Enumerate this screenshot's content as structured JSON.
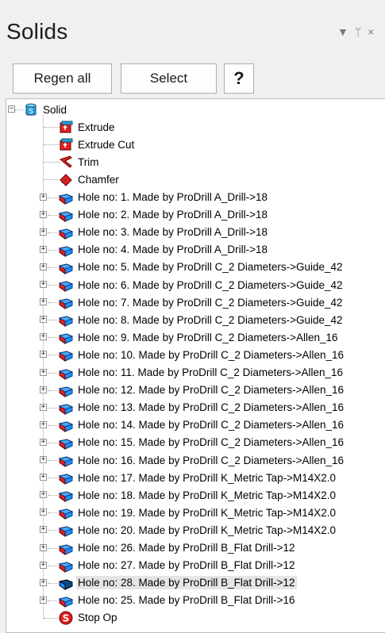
{
  "panel": {
    "title": "Solids",
    "controls": [
      "▼",
      "ᛘ",
      "×"
    ]
  },
  "toolbar": {
    "regen_label": "Regen all",
    "select_label": "Select",
    "help_label": "?"
  },
  "tree": {
    "root": {
      "label": "Solid",
      "icon": "solid-cylinder-icon",
      "expander": "−"
    },
    "ops": [
      {
        "label": "Extrude",
        "icon": "extrude-icon"
      },
      {
        "label": "Extrude Cut",
        "icon": "extrude-cut-icon"
      },
      {
        "label": "Trim",
        "icon": "trim-icon"
      },
      {
        "label": "Chamfer",
        "icon": "chamfer-icon"
      }
    ],
    "holes": [
      {
        "label": "Hole no: 1. Made by ProDrill  A_Drill->18"
      },
      {
        "label": "Hole no: 2. Made by ProDrill  A_Drill->18"
      },
      {
        "label": "Hole no: 3. Made by ProDrill  A_Drill->18"
      },
      {
        "label": "Hole no: 4. Made by ProDrill  A_Drill->18"
      },
      {
        "label": "Hole no: 5. Made by ProDrill  C_2 Diameters->Guide_42"
      },
      {
        "label": "Hole no: 6. Made by ProDrill  C_2 Diameters->Guide_42"
      },
      {
        "label": "Hole no: 7. Made by ProDrill  C_2 Diameters->Guide_42"
      },
      {
        "label": "Hole no: 8. Made by ProDrill  C_2 Diameters->Guide_42"
      },
      {
        "label": "Hole no: 9. Made by ProDrill  C_2 Diameters->Allen_16"
      },
      {
        "label": "Hole no: 10. Made by ProDrill  C_2 Diameters->Allen_16"
      },
      {
        "label": "Hole no: 11. Made by ProDrill  C_2 Diameters->Allen_16"
      },
      {
        "label": "Hole no: 12. Made by ProDrill  C_2 Diameters->Allen_16"
      },
      {
        "label": "Hole no: 13. Made by ProDrill  C_2 Diameters->Allen_16"
      },
      {
        "label": "Hole no: 14. Made by ProDrill  C_2 Diameters->Allen_16"
      },
      {
        "label": "Hole no: 15. Made by ProDrill  C_2 Diameters->Allen_16"
      },
      {
        "label": "Hole no: 16. Made by ProDrill  C_2 Diameters->Allen_16"
      },
      {
        "label": "Hole no: 17. Made by ProDrill  K_Metric Tap->M14X2.0"
      },
      {
        "label": "Hole no: 18. Made by ProDrill  K_Metric Tap->M14X2.0"
      },
      {
        "label": "Hole no: 19. Made by ProDrill  K_Metric Tap->M14X2.0"
      },
      {
        "label": "Hole no: 20. Made by ProDrill  K_Metric Tap->M14X2.0"
      },
      {
        "label": "Hole no: 26. Made by ProDrill  B_Flat Drill->12"
      },
      {
        "label": "Hole no: 27. Made by ProDrill  B_Flat Drill->12"
      },
      {
        "label": "Hole no: 28. Made by ProDrill  B_Flat Drill->12",
        "selected": true
      },
      {
        "label": "Hole no: 25. Made by ProDrill  B_Flat Drill->16"
      }
    ],
    "stop": {
      "label": "Stop Op",
      "icon": "stop-op-icon"
    },
    "expander_plus": "+"
  },
  "colors": {
    "solid_icon": "#2a9fd6",
    "op_icon_red": "#e02020",
    "hole_icon_blue": "#1e90ff",
    "hole_icon_red": "#e02020"
  }
}
